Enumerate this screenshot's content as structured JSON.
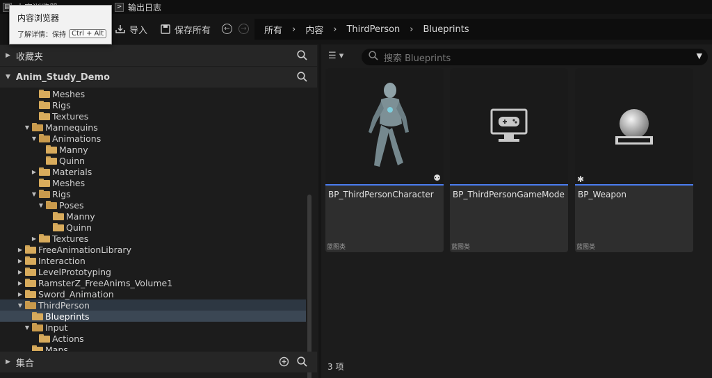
{
  "tabs": {
    "content_browser": "内容浏览器",
    "output_log": "输出日志"
  },
  "tooltip": {
    "title": "内容浏览器",
    "hint": "了解详情：保持",
    "shortcut": "Ctrl + Alt"
  },
  "toolbar": {
    "import_label": "导入",
    "save_all_label": "保存所有"
  },
  "breadcrumb": [
    "所有",
    "内容",
    "ThirdPerson",
    "Blueprints"
  ],
  "left_panel": {
    "favorites_label": "收藏夹",
    "project_label": "Anim_Study_Demo",
    "collections_label": "集合",
    "tree": [
      {
        "label": "Meshes",
        "depth": 3,
        "toggle": ""
      },
      {
        "label": "Rigs",
        "depth": 3,
        "toggle": ""
      },
      {
        "label": "Textures",
        "depth": 3,
        "toggle": ""
      },
      {
        "label": "Mannequins",
        "depth": 2,
        "toggle": "open"
      },
      {
        "label": "Animations",
        "depth": 3,
        "toggle": "open"
      },
      {
        "label": "Manny",
        "depth": 4,
        "toggle": ""
      },
      {
        "label": "Quinn",
        "depth": 4,
        "toggle": ""
      },
      {
        "label": "Materials",
        "depth": 3,
        "toggle": "closed"
      },
      {
        "label": "Meshes",
        "depth": 3,
        "toggle": ""
      },
      {
        "label": "Rigs",
        "depth": 3,
        "toggle": "open"
      },
      {
        "label": "Poses",
        "depth": 4,
        "toggle": "open"
      },
      {
        "label": "Manny",
        "depth": 5,
        "toggle": ""
      },
      {
        "label": "Quinn",
        "depth": 5,
        "toggle": ""
      },
      {
        "label": "Textures",
        "depth": 3,
        "toggle": "closed"
      },
      {
        "label": "FreeAnimationLibrary",
        "depth": 1,
        "toggle": "closed"
      },
      {
        "label": "Interaction",
        "depth": 1,
        "toggle": "closed"
      },
      {
        "label": "LevelPrototyping",
        "depth": 1,
        "toggle": "closed"
      },
      {
        "label": "RamsterZ_FreeAnims_Volume1",
        "depth": 1,
        "toggle": "closed"
      },
      {
        "label": "Sword_Animation",
        "depth": 1,
        "toggle": "closed"
      },
      {
        "label": "ThirdPerson",
        "depth": 1,
        "toggle": "open",
        "state": "hl"
      },
      {
        "label": "Blueprints",
        "depth": 2,
        "toggle": "",
        "state": "sel"
      },
      {
        "label": "Input",
        "depth": 2,
        "toggle": "open"
      },
      {
        "label": "Actions",
        "depth": 3,
        "toggle": ""
      },
      {
        "label": "Maps",
        "depth": 2,
        "toggle": ""
      }
    ]
  },
  "right_panel": {
    "search_placeholder": "搜索 Blueprints",
    "assets": [
      {
        "name": "BP_ThirdPersonCharacter",
        "type": "蓝图类",
        "thumb": "character"
      },
      {
        "name": "BP_ThirdPersonGameMode",
        "type": "蓝图类",
        "thumb": "gamemode-icon"
      },
      {
        "name": "BP_Weapon",
        "type": "蓝图类",
        "thumb": "sphere-icon"
      }
    ],
    "item_count": "3 项"
  },
  "colors": {
    "accent": "#4a7df0",
    "selection": "#3b4754",
    "folder": "#d8ab5c"
  }
}
